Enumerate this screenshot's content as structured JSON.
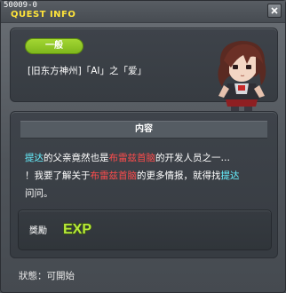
{
  "window": {
    "quest_id": "50009-0",
    "title": "QUEST INFO"
  },
  "quest": {
    "category_badge": "一般",
    "name": "[旧东方神州]「AI」之「爱」"
  },
  "content": {
    "header": "内容",
    "description_segments": [
      {
        "text": "提达",
        "style": "cyan"
      },
      {
        "text": "的父亲竟然也是",
        "style": "normal"
      },
      {
        "text": "布雷兹首脑",
        "style": "red"
      },
      {
        "text": "的开发人员之一…",
        "style": "normal"
      },
      {
        "text": "！我要了解关于",
        "style": "normal"
      },
      {
        "text": "布雷兹首脑",
        "style": "red"
      },
      {
        "text": "的更多情报，就得找",
        "style": "normal"
      },
      {
        "text": "提达",
        "style": "cyan"
      },
      {
        "text": "问问。",
        "style": "normal"
      }
    ]
  },
  "reward": {
    "label": "獎勵",
    "icon": "exp-icon",
    "icon_text": "EXP"
  },
  "status": {
    "text": "狀態：可開始"
  },
  "colors": {
    "title": "#ffe43a",
    "badge": "#8cc425",
    "highlight_cyan": "#66f0ff",
    "highlight_red": "#ff4c4c"
  }
}
